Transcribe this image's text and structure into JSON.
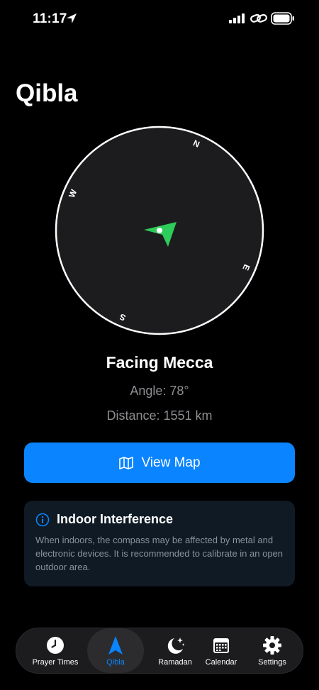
{
  "status": {
    "time": "11:17"
  },
  "page": {
    "title": "Qibla"
  },
  "compass": {
    "north": "N",
    "east": "E",
    "south": "S",
    "west": "W",
    "heading_deg": 78
  },
  "info": {
    "facing": "Facing Mecca",
    "angle": "Angle: 78°",
    "distance": "Distance: 1551 km"
  },
  "map_button": {
    "label": "View Map"
  },
  "notice": {
    "title": "Indoor Interference",
    "body": "When indoors, the compass may be affected by metal and electronic devices. It is recommended to calibrate in an open outdoor area."
  },
  "tabs": [
    {
      "label": "Prayer Times",
      "icon": "clock-icon",
      "active": false
    },
    {
      "label": "Qibla",
      "icon": "qibla-arrow-icon",
      "active": true
    },
    {
      "label": "Ramadan",
      "icon": "moon-stars-icon",
      "active": false
    },
    {
      "label": "Calendar",
      "icon": "calendar-icon",
      "active": false
    },
    {
      "label": "Settings",
      "icon": "gear-icon",
      "active": false
    }
  ],
  "colors": {
    "accent": "#0a84ff",
    "qibla_arrow": "#2ecc5a",
    "compass_face": "#1c1c1e"
  }
}
